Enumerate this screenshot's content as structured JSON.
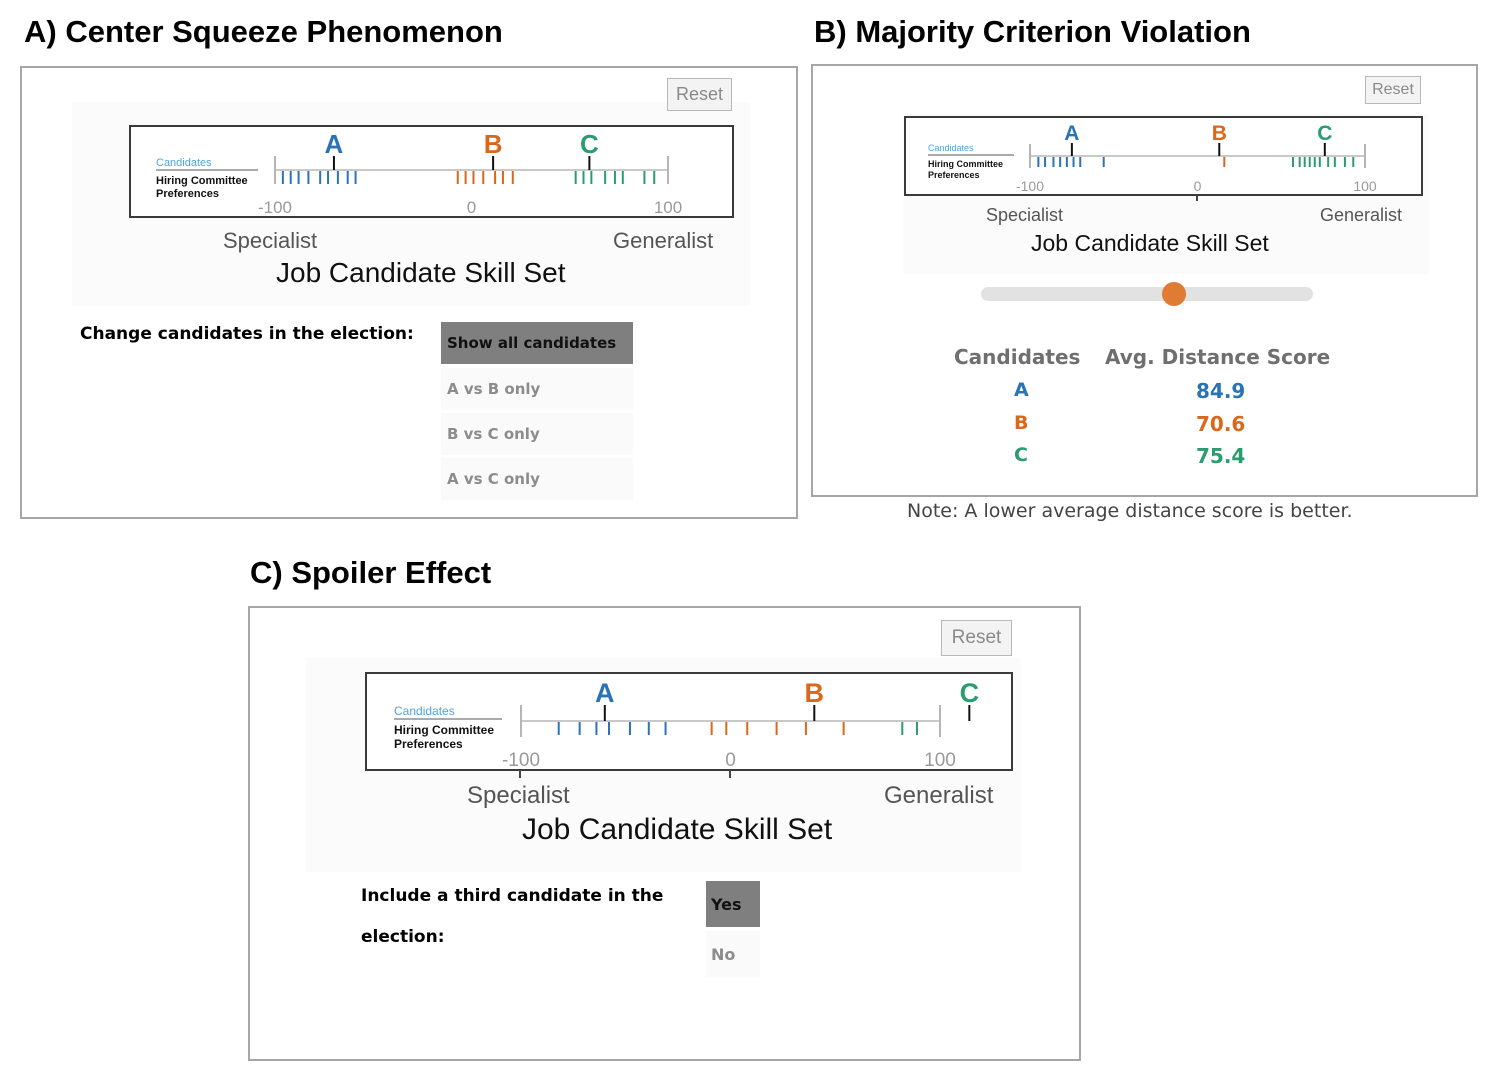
{
  "colors": {
    "A": "#2a74b5",
    "B": "#db6719",
    "C": "#2a9d6e",
    "candidates_legend": "#4fa3e0",
    "selected": "#7f7f7f",
    "slider_thumb": "#e07b33"
  },
  "common": {
    "legend_candidates": "Candidates",
    "legend_hiring_1": "Hiring Committee",
    "legend_hiring_2": "Preferences",
    "tick_labels": [
      "-100",
      "0",
      "100"
    ],
    "left_label": "Specialist",
    "right_label": "Generalist",
    "axis_title": "Job Candidate Skill Set",
    "candidate_names": [
      "A",
      "B",
      "C"
    ]
  },
  "panelA": {
    "title": "A) Center Squeeze Phenomenon",
    "reset": "Reset",
    "prompt": "Change candidates in the election:",
    "options": [
      "Show all candidates",
      "A vs B only",
      "B vs C only",
      "A vs C only"
    ],
    "selected_option": "Show all candidates",
    "chart": {
      "candidates": {
        "A": -70,
        "B": 11,
        "C": 60
      },
      "preferences": {
        "A": [
          -96,
          -92,
          -88,
          -83,
          -77,
          -73,
          -68,
          -63,
          -59
        ],
        "B": [
          -7,
          -3,
          1,
          6,
          12,
          16,
          21
        ],
        "C": [
          53,
          57,
          61,
          68,
          73,
          77,
          88,
          93
        ]
      }
    }
  },
  "panelB": {
    "title": "B) Majority Criterion Violation",
    "reset": "Reset",
    "slider_fraction": 0.58,
    "chart": {
      "candidates": {
        "A": -75,
        "B": 13,
        "C": 76
      },
      "preferences": {
        "A": [
          -95,
          -91,
          -86,
          -82,
          -78,
          -74,
          -70,
          -56
        ],
        "B": [
          16
        ],
        "C": [
          57,
          61,
          64,
          67,
          70,
          73,
          78,
          82,
          88,
          93
        ]
      }
    },
    "table": {
      "col1": "Candidates",
      "col2": "Avg. Distance Score",
      "rows": [
        {
          "name": "A",
          "score": "84.9",
          "color": "A"
        },
        {
          "name": "B",
          "score": "70.6",
          "color": "B"
        },
        {
          "name": "C",
          "score": "75.4",
          "color": "C"
        }
      ]
    },
    "note": "Note: A lower average distance score is better."
  },
  "panelC": {
    "title": "C) Spoiler Effect",
    "reset": "Reset",
    "prompt_line1": "Include a third candidate in the",
    "prompt_line2": "election:",
    "options": [
      "Yes",
      "No"
    ],
    "selected_option": "Yes",
    "chart": {
      "candidates": {
        "A": -60,
        "B": 40,
        "C": 114
      },
      "preferences": {
        "A": [
          -82,
          -72,
          -64,
          -58,
          -48,
          -39,
          -31
        ],
        "B": [
          -9,
          -2,
          8,
          22,
          36,
          54
        ],
        "C": [
          82,
          89
        ]
      }
    }
  }
}
